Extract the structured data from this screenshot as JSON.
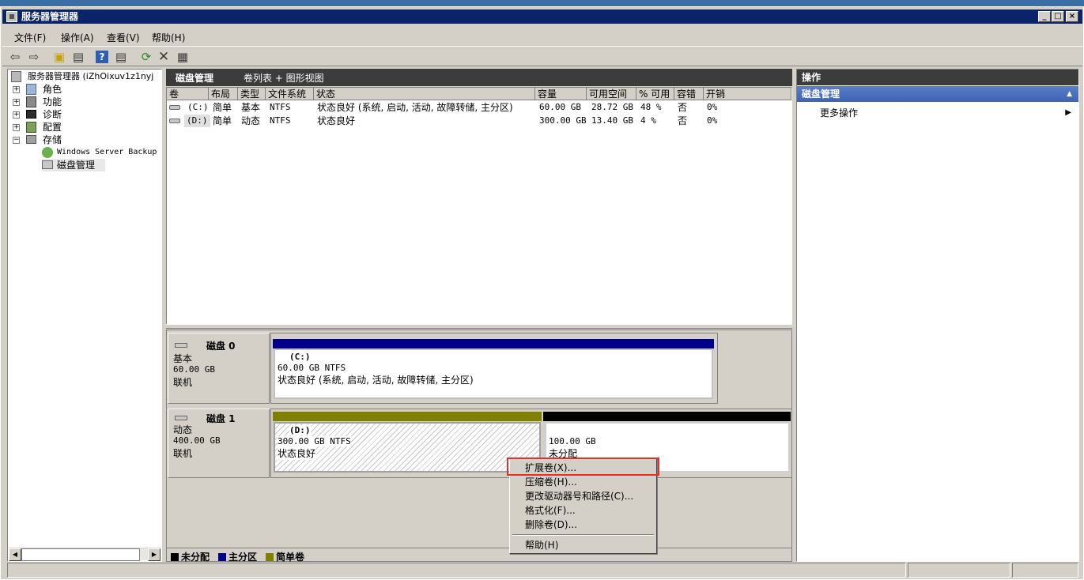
{
  "window": {
    "title": "服务器管理器"
  },
  "menu": [
    "文件(F)",
    "操作(A)",
    "查看(V)",
    "帮助(H)"
  ],
  "tree": {
    "root": "服务器管理器 (iZhOixuv1z1nyj",
    "items": [
      {
        "label": "角色",
        "expander": "+"
      },
      {
        "label": "功能",
        "expander": "+"
      },
      {
        "label": "诊断",
        "expander": "+"
      },
      {
        "label": "配置",
        "expander": "+"
      },
      {
        "label": "存储",
        "expander": "−"
      }
    ],
    "children": [
      "Windows Server Backup",
      "磁盘管理"
    ]
  },
  "center": {
    "title": "磁盘管理",
    "view": "卷列表 + 图形视图",
    "columns": [
      "卷",
      "布局",
      "类型",
      "文件系统",
      "状态",
      "容量",
      "可用空间",
      "% 可用",
      "容错",
      "开销"
    ],
    "rows": [
      {
        "volume": "(C:)",
        "layout": "简单",
        "type": "基本",
        "fs": "NTFS",
        "status": "状态良好 (系统, 启动, 活动, 故障转储, 主分区)",
        "capacity": "60.00 GB",
        "free": "28.72 GB",
        "pct": "48 %",
        "fault": "否",
        "overhead": "0%"
      },
      {
        "volume": "(D:)",
        "layout": "简单",
        "type": "动态",
        "fs": "NTFS",
        "status": "状态良好",
        "capacity": "300.00 GB",
        "free": "13.40 GB",
        "pct": "4 %",
        "fault": "否",
        "overhead": "0%"
      }
    ]
  },
  "disks": [
    {
      "name": "磁盘 0",
      "kind": "基本",
      "size": "60.00 GB",
      "state": "联机",
      "volume": {
        "letter": "(C:)",
        "info": "60.00 GB NTFS",
        "status": "状态良好 (系统, 启动, 活动, 故障转储, 主分区)"
      }
    },
    {
      "name": "磁盘 1",
      "kind": "动态",
      "size": "400.00 GB",
      "state": "联机",
      "volume": {
        "letter": "(D:)",
        "info": "300.00 GB NTFS",
        "status": "状态良好"
      },
      "unallocated": {
        "size": "100.00 GB",
        "label": "未分配"
      }
    }
  ],
  "legend": [
    {
      "label": "未分配",
      "color": "#000000"
    },
    {
      "label": "主分区",
      "color": "#00008b"
    },
    {
      "label": "简单卷",
      "color": "#808000"
    }
  ],
  "context_menu": {
    "items": [
      "扩展卷(X)...",
      "压缩卷(H)...",
      "更改驱动器号和路径(C)...",
      "格式化(F)...",
      "删除卷(D)..."
    ],
    "help": "帮助(H)",
    "highlighted": "扩展卷(X)...",
    "highlight_color": "#e03030"
  },
  "actions": {
    "title": "操作",
    "section": "磁盘管理",
    "more": "更多操作"
  },
  "colors": {
    "title_bar": "#0a246a",
    "primary": "#00008b",
    "simple": "#808000",
    "unallocated": "#000000"
  }
}
